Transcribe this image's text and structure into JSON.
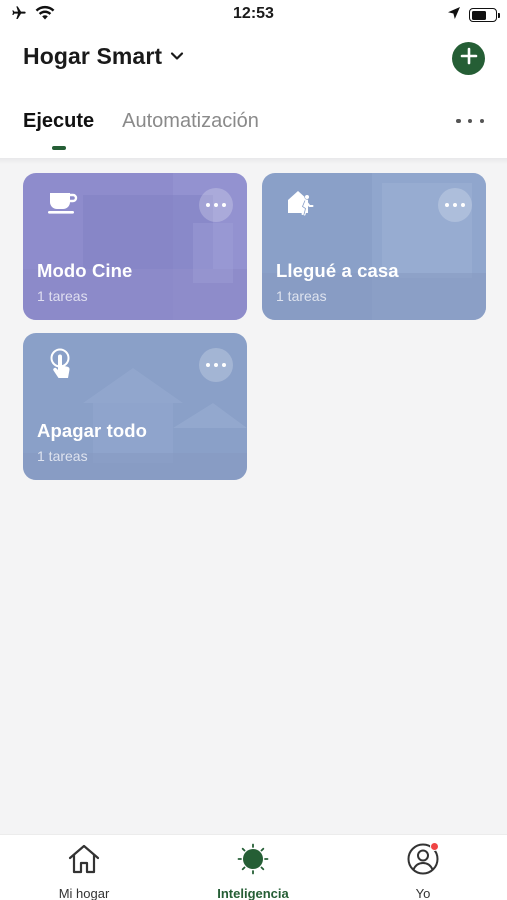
{
  "status_bar": {
    "time": "12:53",
    "left_icons": [
      "airplane-icon",
      "wifi-icon"
    ],
    "right_icons": [
      "location-arrow-icon",
      "battery-icon"
    ]
  },
  "header": {
    "title": "Hogar Smart",
    "title_icon": "chevron-down-icon",
    "add_icon": "plus-icon",
    "accent_color": "#255e35"
  },
  "tabs": [
    {
      "label": "Ejecute",
      "active": true
    },
    {
      "label": "Automatización",
      "active": false
    }
  ],
  "tabs_more_icon": "ellipsis-icon",
  "scenes": [
    {
      "title": "Modo Cine",
      "subtitle": "1 tareas",
      "icon": "coffee-cup-icon",
      "color": "#8e8ccc"
    },
    {
      "title": "Llegué a casa",
      "subtitle": "1 tareas",
      "icon": "arrive-home-icon",
      "color": "#8aa0c8"
    },
    {
      "title": "Apagar todo",
      "subtitle": "1 tareas",
      "icon": "touch-hand-icon",
      "color": "#8aa0c8"
    }
  ],
  "bottom_nav": [
    {
      "label": "Mi hogar",
      "icon": "house-icon",
      "active": false
    },
    {
      "label": "Inteligencia",
      "icon": "sun-icon",
      "active": true
    },
    {
      "label": "Yo",
      "icon": "user-icon",
      "active": false,
      "notification": true
    }
  ]
}
